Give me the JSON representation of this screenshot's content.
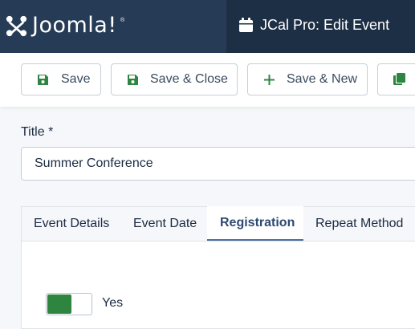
{
  "header": {
    "logo_text": "Joomla!",
    "logo_reg": "®",
    "page_title": "JCal Pro: Edit Event"
  },
  "toolbar": {
    "save_label": "Save",
    "save_close_label": "Save & Close",
    "save_new_label": "Save & New"
  },
  "form": {
    "title_label": "Title *",
    "title_value": "Summer Conference"
  },
  "tabs": [
    {
      "label": "Event Details",
      "active": false
    },
    {
      "label": "Event Date",
      "active": false
    },
    {
      "label": "Registration",
      "active": true
    },
    {
      "label": "Repeat Method",
      "active": false
    }
  ],
  "registration": {
    "toggle_label": "Yes",
    "toggle_on": true
  },
  "colors": {
    "header_bg": "#2a3e58",
    "title_bg": "#1d2f45",
    "toggle_on": "#2d8540",
    "active_tab": "#2d4a73"
  },
  "icons": [
    "joomla-logo-icon",
    "calendar-icon",
    "save-icon",
    "plus-icon",
    "copy-icon"
  ]
}
